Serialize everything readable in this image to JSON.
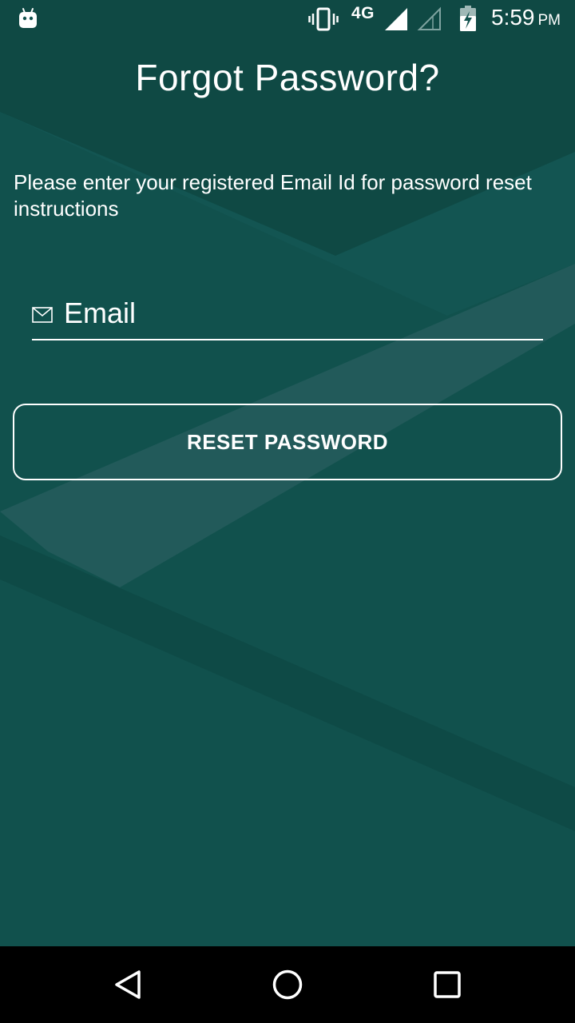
{
  "status_bar": {
    "network_label": "4G",
    "time": "5:59",
    "ampm": "PM",
    "icons": [
      "android-icon",
      "vibrate-icon",
      "signal-icon",
      "signal-empty-icon",
      "battery-charging-icon"
    ]
  },
  "page": {
    "title": "Forgot Password?",
    "instruction": "Please enter your registered Email Id for password reset instructions"
  },
  "email_field": {
    "placeholder": "Email",
    "value": "",
    "icon": "email-icon"
  },
  "reset_button": {
    "label": "RESET PASSWORD"
  },
  "nav_bar": {
    "icons": [
      "back-icon",
      "home-icon",
      "recents-icon"
    ]
  },
  "colors": {
    "background": "#11514d",
    "text": "#ffffff",
    "nav_bar": "#000000"
  }
}
